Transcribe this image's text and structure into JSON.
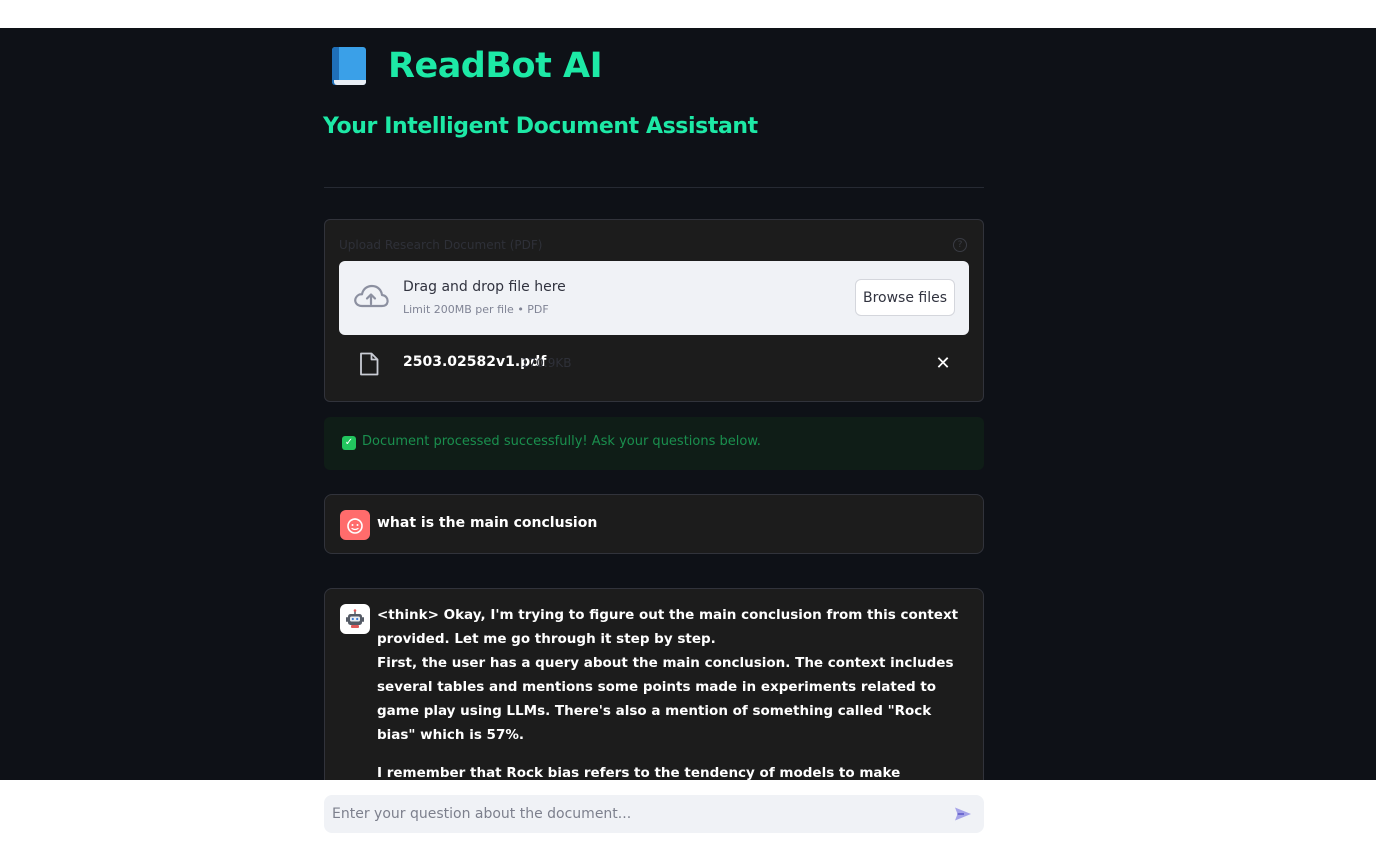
{
  "app": {
    "title": "ReadBot AI",
    "subtitle": "Your Intelligent Document Assistant"
  },
  "uploader": {
    "label": "Upload Research Document (PDF)",
    "dropzone_title": "Drag and drop file here",
    "dropzone_sub": "Limit 200MB per file • PDF",
    "browse_label": "Browse files",
    "file": {
      "name": "2503.02582v1.pdf",
      "size": "170.9KB"
    }
  },
  "status": {
    "success_text": "Document processed successfully! Ask your questions below."
  },
  "chat": {
    "user_message": "what is the main conclusion",
    "bot_paragraphs": [
      "<think> Okay, I'm trying to figure out the main conclusion from this context provided. Let me go through it step by step.",
      "First, the user has a query about the main conclusion. The context includes several tables and mentions some points made in experiments related to game play using LLMs. There's also a mention of something called \"Rock bias\" which is 57%.",
      "I remember that Rock bias refers to the tendency of models to make incorrect predictions or decisions, particularly when the input data has more \"rocky\" (or maybe \"stalemate\") situations."
    ]
  },
  "input": {
    "placeholder": "Enter your question about the document..."
  },
  "icons": {
    "title": "book-icon",
    "upload": "cloud-upload-icon",
    "file": "file-icon",
    "remove": "close-icon",
    "success": "check-icon",
    "user": "user-avatar-icon",
    "bot": "robot-avatar-icon",
    "send": "send-icon"
  },
  "colors": {
    "accent": "#1de9a6",
    "background": "#0e1117",
    "success": "#22c55e",
    "user_avatar": "#ff6c6c"
  }
}
